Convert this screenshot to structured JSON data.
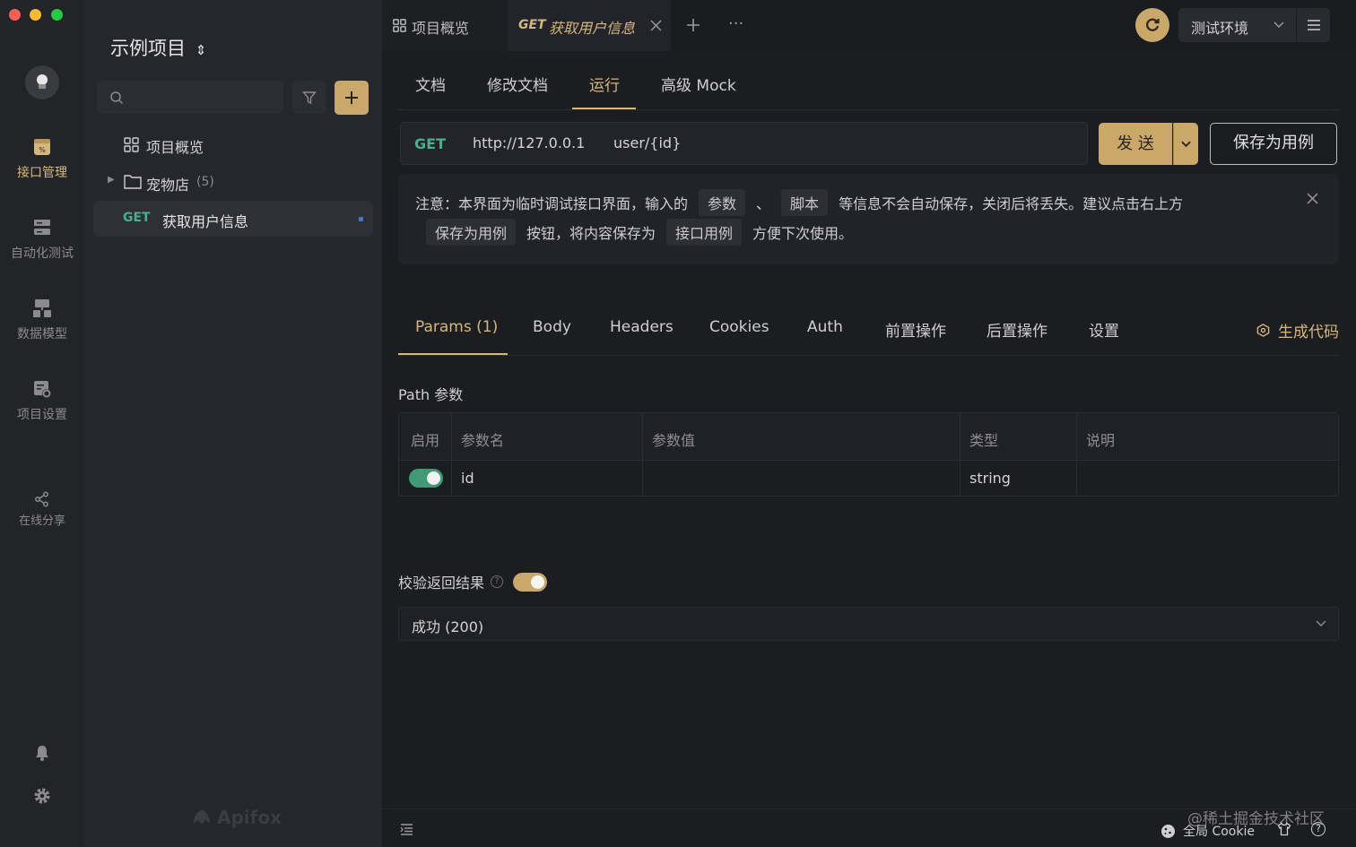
{
  "app": {
    "brand": "Apifox",
    "watermark": "@稀土掘金技术社区"
  },
  "rail": {
    "items": [
      {
        "label": "接口管理",
        "icon": "api-icon",
        "active": true
      },
      {
        "label": "自动化测试",
        "icon": "automation-icon"
      },
      {
        "label": "数据模型",
        "icon": "data-model-icon"
      },
      {
        "label": "项目设置",
        "icon": "project-settings-icon"
      },
      {
        "label": "在线分享",
        "icon": "share-icon"
      }
    ]
  },
  "panel": {
    "project_name": "示例项目",
    "search_placeholder": "",
    "tree": {
      "overview": "项目概览",
      "folder": {
        "label": "宠物店",
        "count": "(5)"
      },
      "endpoint": {
        "method": "GET",
        "label": "获取用户信息"
      }
    }
  },
  "topbar": {
    "tabs": [
      {
        "label": "项目概览"
      },
      {
        "method": "GET",
        "label": "获取用户信息",
        "active": true
      }
    ],
    "env": "测试环境"
  },
  "subtabs": [
    "文档",
    "修改文档",
    "运行",
    "高级 Mock"
  ],
  "active_subtab": "运行",
  "request": {
    "method": "GET",
    "base_url": "http://127.0.0.1",
    "path": "user/{id}",
    "send_label": "发 送",
    "save_label": "保存为用例"
  },
  "notice": {
    "p1": "注意：本界面为临时调试接口界面，输入的",
    "tag1": "参数",
    "sep": "、",
    "tag2": "脚本",
    "p2": "等信息不会自动保存，关闭后将丢失。建议点击右上方",
    "tag3": "保存为用例",
    "p3": "按钮，将内容保存为",
    "tag4": "接口用例",
    "p4": "方便下次使用。"
  },
  "param_tabs": [
    "Params (1)",
    "Body",
    "Headers",
    "Cookies",
    "Auth",
    "前置操作",
    "后置操作",
    "设置"
  ],
  "generate_code": "生成代码",
  "path_params": {
    "title": "Path 参数",
    "headers": [
      "启用",
      "参数名",
      "参数值",
      "类型",
      "说明"
    ],
    "rows": [
      {
        "enabled": true,
        "name": "id",
        "value": "",
        "type": "string",
        "desc": ""
      }
    ]
  },
  "validate": {
    "label": "校验返回结果",
    "enabled": true,
    "selected": "成功 (200)"
  },
  "bottom": {
    "cookie": "全局 Cookie"
  },
  "colors": {
    "accent": "#d5b77c",
    "method_get": "#47b08a",
    "toggle_green": "#3f9b76"
  }
}
